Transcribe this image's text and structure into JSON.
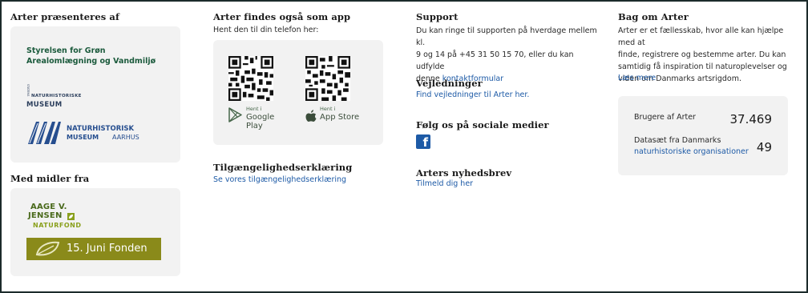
{
  "presenters": {
    "heading": "Arter præsenteres af",
    "logos": {
      "styrelsen_line1": "Styrelsen for Grøn",
      "styrelsen_line2": "Arealomlægning og Vandmiljø",
      "nhm_stack": "STATENS",
      "nhm_line1": "NATURHISTORISKE",
      "nhm_line2": "MUSEUM",
      "nmaa_line1": "NATURHISTORISK",
      "nmaa_line2": "MUSEUM",
      "nmaa_line3": "AARHUS"
    }
  },
  "funders": {
    "heading": "Med midler fra",
    "aage_line1": "AAGE V.",
    "aage_line2": "JENSEN",
    "aage_line3": "NATURFOND",
    "juni_label": "15. Juni Fonden"
  },
  "app": {
    "heading": "Arter findes også som app",
    "subtitle": "Hent den til din telefon her:",
    "google_small": "Hent i",
    "google_name": "Google Play",
    "apple_small": "Hent i",
    "apple_name": "App Store"
  },
  "accessibility": {
    "heading": "Tilgængelighedserklæring",
    "link": "Se vores tilgængelighedserklæring"
  },
  "support": {
    "heading": "Support",
    "line1": "Du kan ringe til supporten på hverdage mellem kl.",
    "line2": "9 og 14 på +45 31 50 15 70, eller du kan udfylde",
    "line3_prefix": "denne",
    "line3_link": "kontaktformular"
  },
  "guides": {
    "heading": "Vejledninger",
    "link": "Find vejledninger til Arter her."
  },
  "social": {
    "heading": "Følg os på sociale medier",
    "facebook_glyph": "f"
  },
  "newsletter": {
    "heading": "Arters nyhedsbrev",
    "link": "Tilmeld dig her"
  },
  "about": {
    "heading": "Bag om Arter",
    "line1": "Arter er et fællesskab, hvor alle kan hjælpe med at",
    "line2": "finde, registrere og bestemme arter. Du kan",
    "line3": "samtidig få inspiration til naturoplevelser og",
    "line4": "viden om Danmarks artsrigdom.",
    "read_more": "Læs mere"
  },
  "stats": {
    "users_label": "Brugere af Arter",
    "users_value": "37.469",
    "datasets_label": "Datasæt fra Danmarks",
    "datasets_link": "naturhistoriske organisationer",
    "datasets_value": "49"
  },
  "colors": {
    "link": "#1d5aa6",
    "card": "#f2f2f2",
    "frame": "#1c2b2b",
    "styrelsen_green": "#1b5a3c",
    "nhm_blue": "#264e8f",
    "juni_olive": "#8a8a1a"
  }
}
